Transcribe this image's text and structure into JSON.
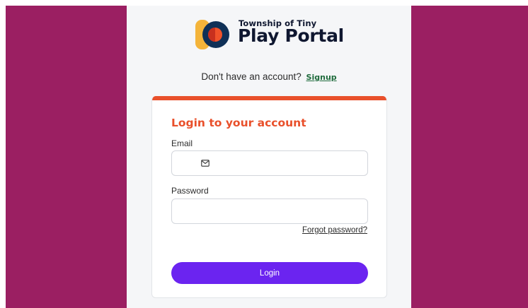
{
  "brand": {
    "small_text": "Township of Tiny",
    "big_text": "Play Portal",
    "colors": {
      "navy": "#0f3057",
      "orange": "#f0522a",
      "yellow": "#f4b43a",
      "red": "#c8301e"
    }
  },
  "signup": {
    "prompt": "Don't have an account?",
    "link_label": "Signup"
  },
  "login_card": {
    "title": "Login to your account",
    "email_label": "Email",
    "email_value": "",
    "password_label": "Password",
    "password_value": "",
    "forgot_label": "Forgot password?",
    "submit_label": "Login",
    "email_icon": "mail-icon"
  },
  "theme": {
    "background": "#9b1f62",
    "panel": "#f5f6f8",
    "accent_bar": "#e9502b",
    "button": "#6b24f0",
    "link": "#1e6b3c"
  }
}
